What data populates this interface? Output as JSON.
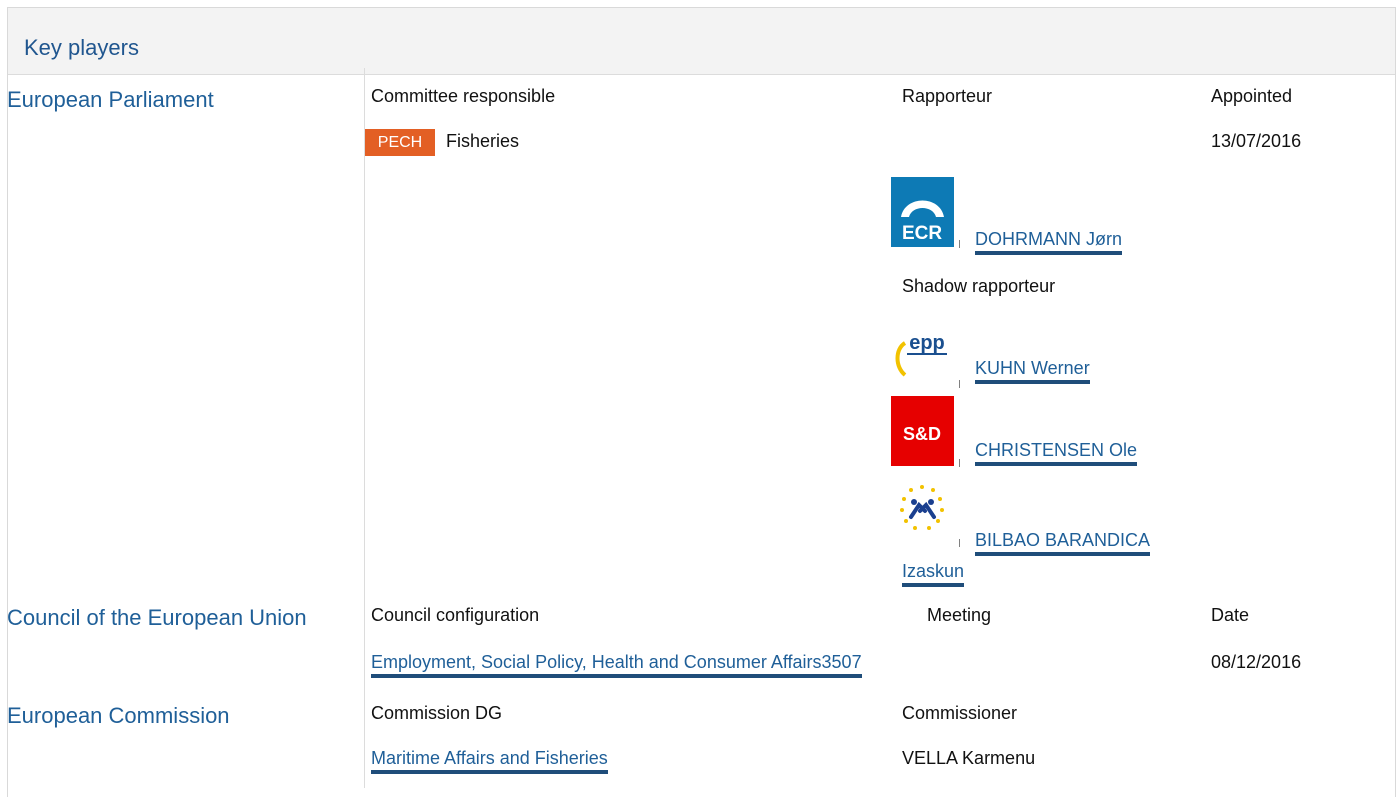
{
  "header": {
    "title": "Key players"
  },
  "parliament": {
    "title": "European Parliament",
    "col_committee": "Committee responsible",
    "col_rapporteur": "Rapporteur",
    "col_appointed": "Appointed",
    "committee_badge": "PECH",
    "committee_name": "Fisheries",
    "appointed_date": "13/07/2016",
    "rapporteur": {
      "group_logo": "ECR",
      "name": "DOHRMANN Jørn"
    },
    "shadow_label": "Shadow rapporteur",
    "shadows": [
      {
        "group_logo": "epp",
        "name": "KUHN Werner"
      },
      {
        "group_logo": "S&D",
        "name": "CHRISTENSEN Ole"
      },
      {
        "group_logo": "renew-stars-icon",
        "name_line1": "BILBAO BARANDICA",
        "name_line2": "Izaskun"
      }
    ]
  },
  "council": {
    "title": "Council of the European Union",
    "col_configuration": "Council configuration",
    "col_meeting": "Meeting",
    "col_date": "Date",
    "configuration_link": "Employment, Social Policy, Health and Consumer Affairs3507",
    "date": "08/12/2016"
  },
  "commission": {
    "title": "European Commission",
    "col_dg": "Commission DG",
    "col_commissioner": "Commissioner",
    "dg_link": "Maritime Affairs and Fisheries",
    "commissioner": "VELLA Karmenu"
  },
  "colors": {
    "accent": "#1f5f98",
    "badge": "#e35f24",
    "ecr": "#0d7ab5",
    "sd": "#e60000"
  }
}
